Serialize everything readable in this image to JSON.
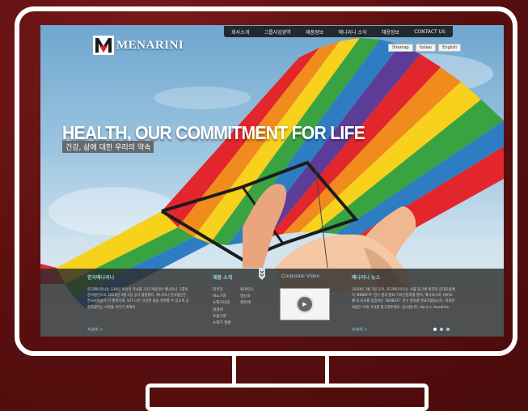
{
  "brand": {
    "name": "MENARINI"
  },
  "nav": {
    "items": [
      "회사소개",
      "그룹사업영역",
      "제품정보",
      "메나리니 소식",
      "채용정보",
      "CONTACT US"
    ]
  },
  "lang_links": [
    "Sitemap",
    "Italian",
    "English"
  ],
  "hero": {
    "headline": "HEALTH, OUR COMMITMENT FOR LIFE",
    "subheadline": "건강, 삶에 대한 우리의 약속"
  },
  "panels": {
    "about": {
      "title": "한국메나리니",
      "body": "한국메나리니는 130년 이상의 역사를 가진 이탈리아 메나리니 그룹의 한국법인으로 2013년 3월 1일 공식 출범했다. 메나리니 한국법인은 한국사람들이 더 행복하게, 보다 나은 건강한 삶을 영위할 수 있도록 공헌하겠다는 사명을 지키기 위해서.",
      "more": "자세히 >"
    },
    "products": {
      "title": "제품 소개",
      "col1": [
        "피부과",
        "비뇨기과",
        "소화기내과",
        "항생제",
        "호흡기과",
        "소화기 질환"
      ],
      "col2": [
        "류마티스",
        "정신과",
        "해독제"
      ]
    },
    "video": {
      "title": "Corporate Video"
    },
    "news": {
      "title": "메나리니 뉴스",
      "body": "2020년 3월 7일 오전, 한국메나리니는 서울 중구에 위치한 중대포럼에서 'BENEFIT' 연구 결과 발표 기자간담회를 열어, 메나리니의 '네비보롤'의 효과를 입증하는 'BENEFIT' 연구 결과를 발표하였습니다. 자세한 내용은 아래 기사를 참고해주세요. 감사합니다. No.뉴스 Headline",
      "more": "자세히 >"
    }
  },
  "colors": {
    "accent": "#8fd3e0",
    "panel": "#2d2d2d",
    "background": "#5a0f0f"
  },
  "icons": {
    "play": "play-icon",
    "logo": "menarini-m-logo"
  }
}
